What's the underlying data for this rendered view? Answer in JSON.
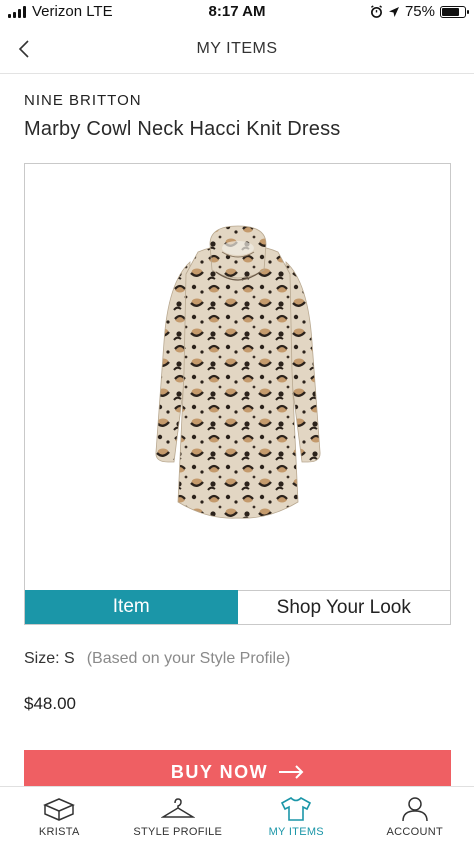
{
  "status_bar": {
    "carrier": "Verizon LTE",
    "time": "8:17 AM",
    "battery": "75%",
    "battery_level": 0.75
  },
  "nav": {
    "title": "MY ITEMS",
    "back_icon": "chevron-left-icon"
  },
  "product": {
    "brand": "NINE BRITTON",
    "name": "Marby Cowl Neck Hacci Knit Dress",
    "image_icon": "leopard-print-dress-image",
    "size_label": "Size: S",
    "size_hint": "(Based on your Style Profile)",
    "price": "$48.00"
  },
  "tabs": [
    {
      "label": "Item",
      "active": true
    },
    {
      "label": "Shop Your Look",
      "active": false
    }
  ],
  "buy_button": {
    "label": "BUY NOW",
    "icon": "arrow-right-icon",
    "color": "#ef5f63"
  },
  "tab_bar": [
    {
      "label": "KRISTA",
      "icon": "box-icon",
      "active": false
    },
    {
      "label": "STYLE PROFILE",
      "icon": "hanger-icon",
      "active": false
    },
    {
      "label": "MY ITEMS",
      "icon": "shirt-icon",
      "active": true
    },
    {
      "label": "ACCOUNT",
      "icon": "person-icon",
      "active": false
    }
  ],
  "colors": {
    "accent": "#1b96a8",
    "buy": "#ef5f63"
  }
}
